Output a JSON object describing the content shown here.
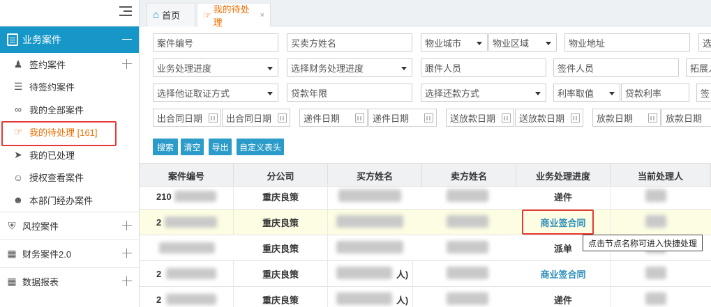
{
  "sidebar": {
    "section_title": "业务案件",
    "items": [
      {
        "label": "签约案件",
        "icon": "person-icon",
        "expand": true
      },
      {
        "label": "待签约案件",
        "icon": "clipboard-icon",
        "expand": false
      },
      {
        "label": "我的全部案件",
        "icon": "circles-icon",
        "expand": false
      },
      {
        "label": "我的待处理 [161]",
        "icon": "hand-pointer-icon",
        "expand": false,
        "active": true
      },
      {
        "label": "我的已处理",
        "icon": "paper-plane-icon",
        "expand": false
      },
      {
        "label": "授权查看案件",
        "icon": "user-icon",
        "expand": false
      },
      {
        "label": "本部门经办案件",
        "icon": "users-icon",
        "expand": false
      }
    ],
    "groups": [
      {
        "label": "风控案件",
        "icon": "shield-icon"
      },
      {
        "label": "财务案件2.0",
        "icon": "money-icon"
      },
      {
        "label": "数据报表",
        "icon": "table-icon"
      }
    ]
  },
  "tabs": [
    {
      "label": "首页",
      "icon": "home-icon"
    },
    {
      "label": "我的待处理",
      "icon": "hand-pointer-icon",
      "close": "×"
    }
  ],
  "filters": {
    "row1": [
      "案件编号",
      "买卖方姓名",
      "物业城市",
      "物业区域",
      "物业地址",
      "选"
    ],
    "row2": [
      "业务处理进度",
      "选择财务处理进度",
      "跟件人员",
      "签件人员",
      "拓展人"
    ],
    "row3": [
      "选择他证取证方式",
      "贷款年限",
      "选择还款方式",
      "利率取值",
      "贷款利率",
      "签"
    ],
    "row4": [
      "出合同日期",
      "出合同日期",
      "递件日期",
      "递件日期",
      "送放款日期",
      "送放款日期",
      "放款日期",
      "放款日期"
    ]
  },
  "buttons": {
    "search": "搜索",
    "clear": "清空",
    "export": "导出",
    "custom_header": "自定义表头"
  },
  "table": {
    "headers": [
      "案件编号",
      "分公司",
      "买方姓名",
      "卖方姓名",
      "业务处理进度",
      "当前处理人"
    ],
    "rows": [
      {
        "case_no": "210",
        "branch": "重庆良策",
        "buyer": "",
        "seller": "",
        "progress": "递件",
        "progress_link": false,
        "handler": ""
      },
      {
        "case_no": "2",
        "branch": "重庆良策",
        "buyer": "",
        "seller": "",
        "progress": "商业签合同",
        "progress_link": true,
        "handler": "",
        "highlight": true
      },
      {
        "case_no": "",
        "branch": "重庆良策",
        "buyer": "",
        "seller": "",
        "progress": "派单",
        "progress_link": false,
        "handler": ""
      },
      {
        "case_no": "2",
        "branch": "重庆良策",
        "buyer": "人)",
        "seller": "",
        "progress": "商业签合同",
        "progress_link": true,
        "handler": ""
      },
      {
        "case_no": "2",
        "branch": "重庆良策",
        "buyer": "人)",
        "seller": "",
        "progress": "递件",
        "progress_link": false,
        "handler": ""
      }
    ]
  },
  "tooltip": "点击节点名称可进入快捷处理"
}
